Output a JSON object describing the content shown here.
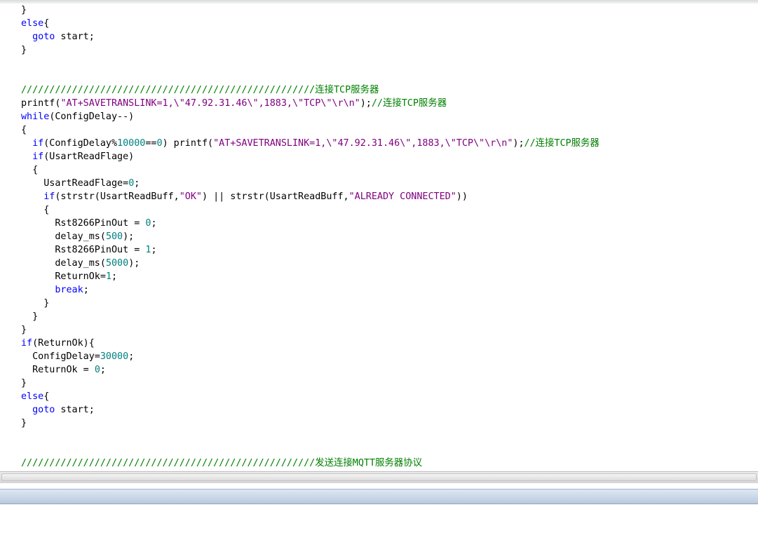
{
  "editor": {
    "lines": [
      [
        {
          "t": "}",
          "c": ""
        }
      ],
      [
        {
          "t": "else",
          "c": "kw"
        },
        {
          "t": "{",
          "c": ""
        }
      ],
      [
        {
          "t": "  ",
          "c": ""
        },
        {
          "t": "goto",
          "c": "kw"
        },
        {
          "t": " start;",
          "c": ""
        }
      ],
      [
        {
          "t": "}",
          "c": ""
        }
      ],
      [],
      [],
      [
        {
          "t": "////////////////////////////////////////////////////连接TCP服务器",
          "c": "cm"
        }
      ],
      [
        {
          "t": "printf(",
          "c": ""
        },
        {
          "t": "\"AT+SAVETRANSLINK=1,\\\"47.92.31.46\\\",1883,\\\"TCP\\\"\\r\\n\"",
          "c": "str"
        },
        {
          "t": ");",
          "c": ""
        },
        {
          "t": "//连接TCP服务器",
          "c": "cm"
        }
      ],
      [
        {
          "t": "while",
          "c": "kw"
        },
        {
          "t": "(ConfigDelay--)",
          "c": ""
        }
      ],
      [
        {
          "t": "{",
          "c": ""
        }
      ],
      [
        {
          "t": "  ",
          "c": ""
        },
        {
          "t": "if",
          "c": "kw"
        },
        {
          "t": "(ConfigDelay%",
          "c": ""
        },
        {
          "t": "10000",
          "c": "num"
        },
        {
          "t": "==",
          "c": ""
        },
        {
          "t": "0",
          "c": "num"
        },
        {
          "t": ") printf(",
          "c": ""
        },
        {
          "t": "\"AT+SAVETRANSLINK=1,\\\"47.92.31.46\\\",1883,\\\"TCP\\\"\\r\\n\"",
          "c": "str"
        },
        {
          "t": ");",
          "c": ""
        },
        {
          "t": "//连接TCP服务器",
          "c": "cm"
        }
      ],
      [
        {
          "t": "  ",
          "c": ""
        },
        {
          "t": "if",
          "c": "kw"
        },
        {
          "t": "(UsartReadFlage)",
          "c": ""
        }
      ],
      [
        {
          "t": "  {",
          "c": ""
        }
      ],
      [
        {
          "t": "    UsartReadFlage=",
          "c": ""
        },
        {
          "t": "0",
          "c": "num"
        },
        {
          "t": ";",
          "c": ""
        }
      ],
      [
        {
          "t": "    ",
          "c": ""
        },
        {
          "t": "if",
          "c": "kw"
        },
        {
          "t": "(strstr(UsartReadBuff,",
          "c": ""
        },
        {
          "t": "\"OK\"",
          "c": "str"
        },
        {
          "t": ") || strstr(UsartReadBuff,",
          "c": ""
        },
        {
          "t": "\"ALREADY CONNECTED\"",
          "c": "str"
        },
        {
          "t": "))",
          "c": ""
        }
      ],
      [
        {
          "t": "    {",
          "c": ""
        }
      ],
      [
        {
          "t": "      Rst8266PinOut = ",
          "c": ""
        },
        {
          "t": "0",
          "c": "num"
        },
        {
          "t": ";",
          "c": ""
        }
      ],
      [
        {
          "t": "      delay_ms(",
          "c": ""
        },
        {
          "t": "500",
          "c": "num"
        },
        {
          "t": ");",
          "c": ""
        }
      ],
      [
        {
          "t": "      Rst8266PinOut = ",
          "c": ""
        },
        {
          "t": "1",
          "c": "num"
        },
        {
          "t": ";",
          "c": ""
        }
      ],
      [
        {
          "t": "      delay_ms(",
          "c": ""
        },
        {
          "t": "5000",
          "c": "num"
        },
        {
          "t": ");",
          "c": ""
        }
      ],
      [
        {
          "t": "      ReturnOk=",
          "c": ""
        },
        {
          "t": "1",
          "c": "num"
        },
        {
          "t": ";",
          "c": ""
        }
      ],
      [
        {
          "t": "      ",
          "c": ""
        },
        {
          "t": "break",
          "c": "kw"
        },
        {
          "t": ";",
          "c": ""
        }
      ],
      [
        {
          "t": "    }",
          "c": ""
        }
      ],
      [
        {
          "t": "  }",
          "c": ""
        }
      ],
      [
        {
          "t": "}",
          "c": ""
        }
      ],
      [
        {
          "t": "if",
          "c": "kw"
        },
        {
          "t": "(ReturnOk){",
          "c": ""
        }
      ],
      [
        {
          "t": "  ConfigDelay=",
          "c": ""
        },
        {
          "t": "30000",
          "c": "num"
        },
        {
          "t": ";",
          "c": ""
        }
      ],
      [
        {
          "t": "  ReturnOk = ",
          "c": ""
        },
        {
          "t": "0",
          "c": "num"
        },
        {
          "t": ";",
          "c": ""
        }
      ],
      [
        {
          "t": "}",
          "c": ""
        }
      ],
      [
        {
          "t": "else",
          "c": "kw"
        },
        {
          "t": "{",
          "c": ""
        }
      ],
      [
        {
          "t": "  ",
          "c": ""
        },
        {
          "t": "goto",
          "c": "kw"
        },
        {
          "t": " start;",
          "c": ""
        }
      ],
      [
        {
          "t": "}",
          "c": ""
        }
      ],
      [],
      [],
      [
        {
          "t": "////////////////////////////////////////////////////发送连接MQTT服务器协议",
          "c": "cm"
        }
      ]
    ]
  },
  "colors": {
    "keyword": "#0000ff",
    "string": "#800080",
    "number": "#008080",
    "comment": "#008000",
    "text": "#000000"
  }
}
